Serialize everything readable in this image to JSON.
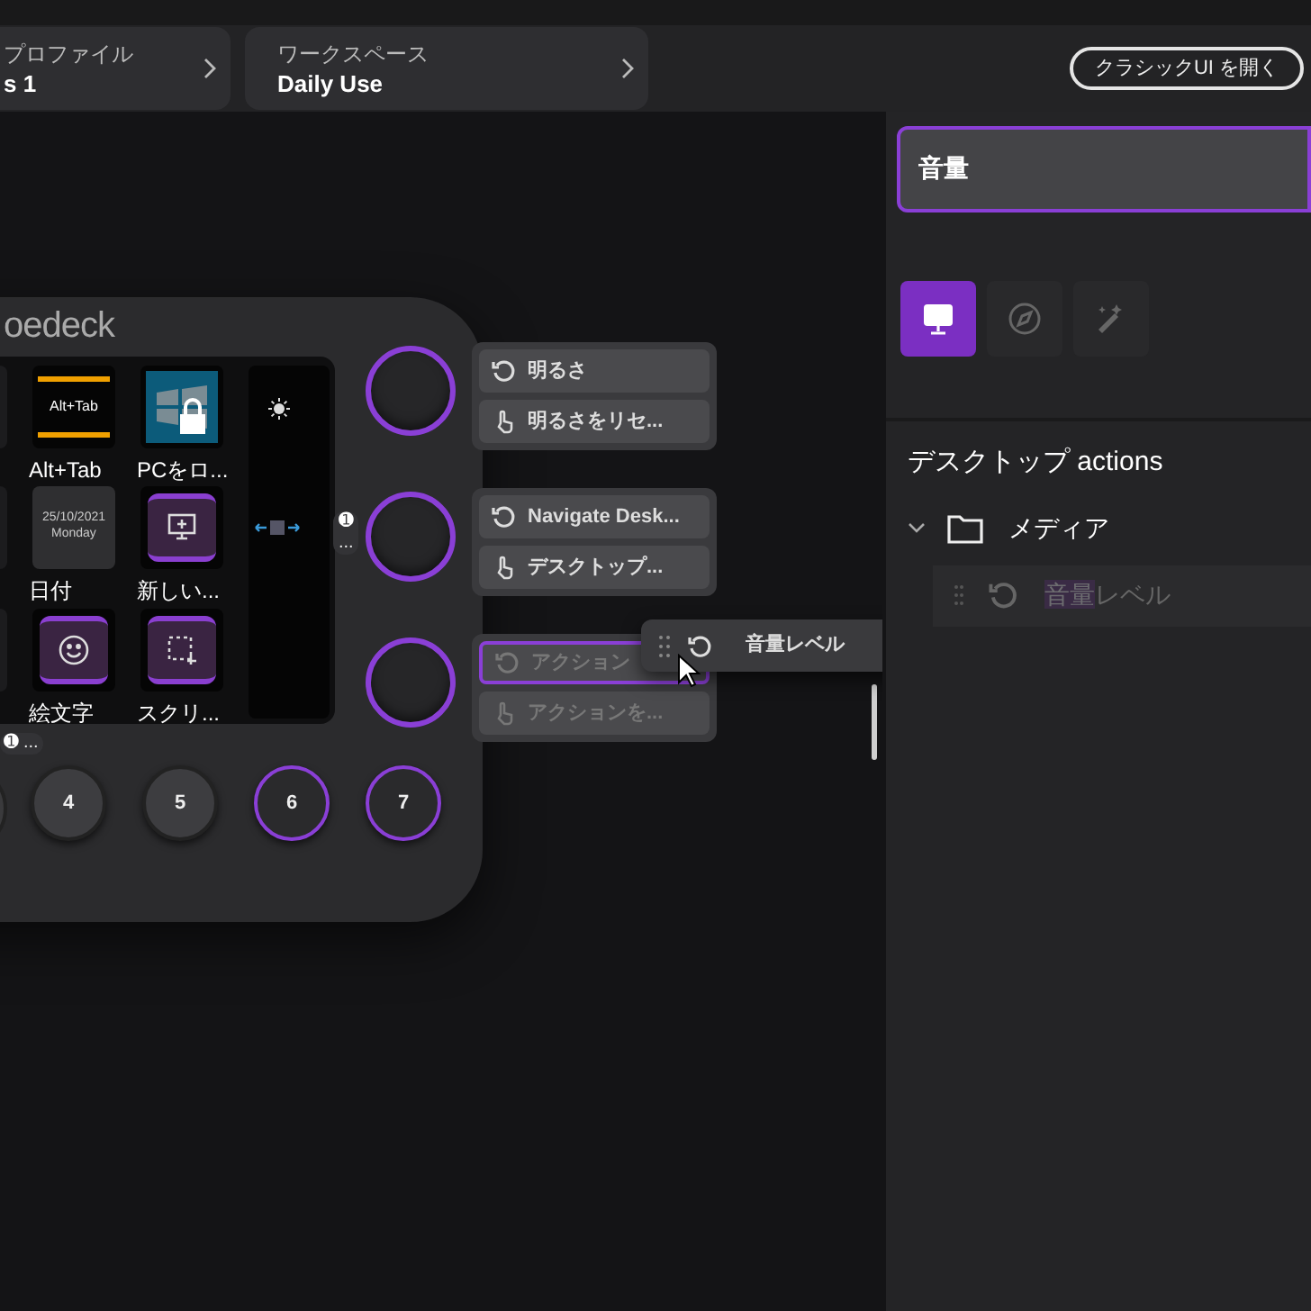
{
  "header": {
    "profile": {
      "label": "プロファイル",
      "value": "s 1"
    },
    "workspace": {
      "label": "ワークスペース",
      "value": "Daily Use"
    },
    "classic_button": "クラシックUI を開く"
  },
  "deck": {
    "logo": "oedeck",
    "keys": [
      {
        "kind": "alttab",
        "label": "Alt+Tab",
        "key_text": "Alt+Tab"
      },
      {
        "kind": "lock",
        "label": "PCをロ..."
      },
      {
        "kind": "date",
        "label": "日付",
        "key_text": "25/10/2021",
        "key_subtext": "Monday"
      },
      {
        "kind": "monitor",
        "label": "新しい..."
      },
      {
        "kind": "emoji",
        "label": "絵文字"
      },
      {
        "kind": "screenshot",
        "label": "スクリ..."
      }
    ],
    "page_badges": [
      {
        "number": "➊",
        "more": "..."
      },
      {
        "number": "➊",
        "more": "..."
      }
    ],
    "dials": [
      {
        "selected": true,
        "actions": [
          {
            "kind": "rotate",
            "label": "明るさ",
            "disabled": false,
            "highlighted": false
          },
          {
            "kind": "press",
            "label": "明るさをリセ...",
            "disabled": false,
            "highlighted": false
          }
        ]
      },
      {
        "selected": true,
        "actions": [
          {
            "kind": "rotate",
            "label": "Navigate Desk...",
            "disabled": false,
            "highlighted": false
          },
          {
            "kind": "press",
            "label": "デスクトップ...",
            "disabled": false,
            "highlighted": false
          }
        ]
      },
      {
        "selected": true,
        "actions": [
          {
            "kind": "rotate",
            "label": "アクション",
            "disabled": true,
            "highlighted": true
          },
          {
            "kind": "press",
            "label": "アクションを...",
            "disabled": true,
            "highlighted": false
          }
        ]
      }
    ],
    "buttons": [
      {
        "label": "4",
        "selected": false
      },
      {
        "label": "5",
        "selected": false
      },
      {
        "label": "6",
        "selected": true
      },
      {
        "label": "7",
        "selected": true
      }
    ],
    "drag_card": {
      "label": "音量レベル"
    }
  },
  "sidebar": {
    "search": {
      "value": "音量"
    },
    "categories": [
      {
        "kind": "os",
        "selected": true
      },
      {
        "kind": "compass",
        "selected": false
      },
      {
        "kind": "wand",
        "selected": false
      }
    ],
    "section_title": "デスクトップ actions",
    "folders": [
      {
        "label": "メディア",
        "expanded": true,
        "children": [
          {
            "match": "音量",
            "rest": "レベル"
          }
        ]
      }
    ]
  }
}
